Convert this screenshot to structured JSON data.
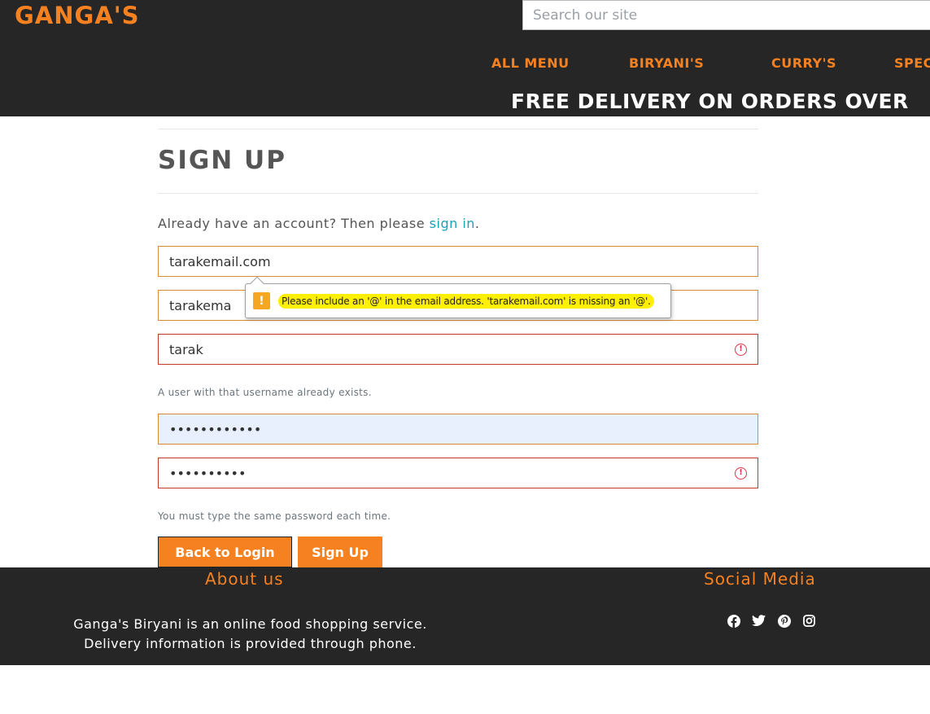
{
  "header": {
    "logo": "GANGA'S",
    "search_placeholder": "Search our site",
    "nav": [
      {
        "label": "ALL MENU"
      },
      {
        "label": "BIRYANI'S"
      },
      {
        "label": "CURRY'S"
      },
      {
        "label": "SPEC"
      }
    ],
    "banner": "FREE DELIVERY ON ORDERS OVER"
  },
  "main": {
    "title": "SIGN UP",
    "signin_prefix": "Already have an account? Then please ",
    "signin_link": "sign in",
    "signin_suffix": ".",
    "email_value": "tarakemail.com",
    "email_confirm_value": "tarakema",
    "username_value": "tarak",
    "username_error": "A user with that username already exists.",
    "password_value": "••••••••••••",
    "password_confirm_value": "••••••••••",
    "password_error": "You must type the same password each time.",
    "back_button": "Back to Login",
    "signup_button": "Sign Up",
    "tooltip_text": "Please include an '@' in the email address. 'tarakemail.com' is missing an '@'."
  },
  "footer": {
    "about_title": "About us",
    "about_line1": "Ganga's Biryani is an online food shopping service.",
    "about_line2": "Delivery information is provided through phone.",
    "social_title": "Social Media",
    "icons": [
      "facebook-icon",
      "twitter-icon",
      "pinterest-icon",
      "instagram-icon"
    ]
  },
  "colors": {
    "accent": "#f68121",
    "header_bg": "#262626",
    "link": "#17a2b8",
    "error": "#dc3545",
    "warning": "#f5a623",
    "highlight": "#ffef00"
  }
}
